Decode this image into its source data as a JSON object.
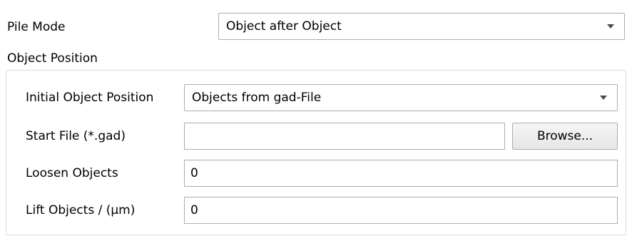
{
  "pile_mode": {
    "label": "Pile Mode",
    "value": "Object after Object"
  },
  "object_position": {
    "group_title": "Object Position",
    "initial_position": {
      "label": "Initial Object Position",
      "value": "Objects from gad-File"
    },
    "start_file": {
      "label": "Start File (*.gad)",
      "value": "",
      "browse_label": "Browse..."
    },
    "loosen_objects": {
      "label": "Loosen Objects",
      "value": "0"
    },
    "lift_objects": {
      "label": "Lift Objects / (µm)",
      "value": "0"
    }
  },
  "icons": {
    "dropdown": "chevron-down-icon"
  }
}
